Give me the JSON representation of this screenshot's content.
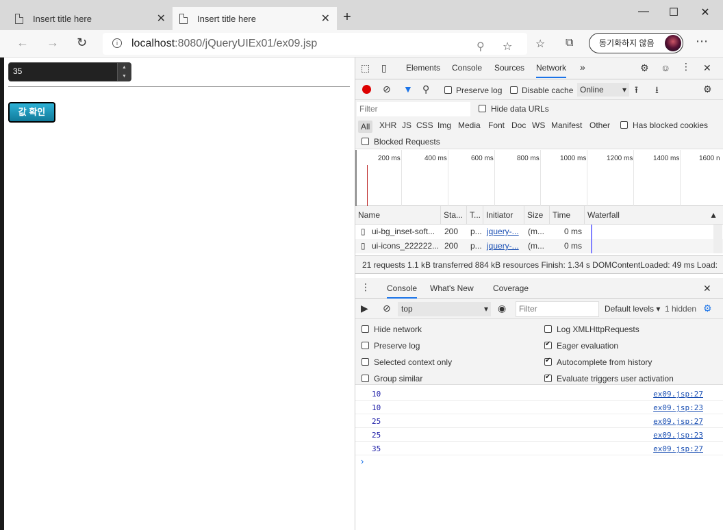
{
  "tabs": [
    {
      "title": "Insert title here"
    },
    {
      "title": "Insert title here"
    }
  ],
  "address": {
    "host": "localhost",
    "path": ":8080/jQueryUIEx01/ex09.jsp"
  },
  "sync_button": "동기화하지 않음",
  "page": {
    "spinner_value": "35",
    "check_button": "값 확인"
  },
  "devtools": {
    "tabs": [
      "Elements",
      "Console",
      "Sources",
      "Network"
    ],
    "active_tab": "Network",
    "network_toolbar": {
      "preserve_log": "Preserve log",
      "disable_cache": "Disable cache",
      "throttle": "Online"
    },
    "filter": {
      "placeholder": "Filter",
      "hide_data_urls": "Hide data URLs",
      "types": [
        "All",
        "XHR",
        "JS",
        "CSS",
        "Img",
        "Media",
        "Font",
        "Doc",
        "WS",
        "Manifest",
        "Other"
      ],
      "has_blocked_cookies": "Has blocked cookies",
      "blocked_requests": "Blocked Requests"
    },
    "timeline_ticks": [
      "200 ms",
      "400 ms",
      "600 ms",
      "800 ms",
      "1000 ms",
      "1200 ms",
      "1400 ms",
      "1600 n"
    ],
    "table": {
      "headers": [
        "Name",
        "Sta...",
        "T...",
        "Initiator",
        "Size",
        "Time",
        "Waterfall"
      ],
      "rows": [
        {
          "name": "ui-bg_inset-soft...",
          "status": "200",
          "type": "p...",
          "initiator": "jquery-...",
          "size": "(m...",
          "time": "0 ms"
        },
        {
          "name": "ui-icons_222222...",
          "status": "200",
          "type": "p...",
          "initiator": "jquery-...",
          "size": "(m...",
          "time": "0 ms"
        }
      ]
    },
    "summary": "21 requests   1.1 kB transferred   884 kB resources   Finish: 1.34 s   DOMContentLoaded: 49 ms   Load:",
    "drawer": {
      "tabs": [
        "Console",
        "What's New",
        "Coverage"
      ],
      "active": "Console"
    },
    "console_toolbar": {
      "context": "top",
      "filter_placeholder": "Filter",
      "levels": "Default levels",
      "hidden": "1 hidden"
    },
    "settings_left": [
      {
        "label": "Hide network",
        "checked": false
      },
      {
        "label": "Preserve log",
        "checked": false
      },
      {
        "label": "Selected context only",
        "checked": false
      },
      {
        "label": "Group similar",
        "checked": false
      }
    ],
    "settings_right": [
      {
        "label": "Log XMLHttpRequests",
        "checked": false
      },
      {
        "label": "Eager evaluation",
        "checked": true
      },
      {
        "label": "Autocomplete from history",
        "checked": true
      },
      {
        "label": "Evaluate triggers user activation",
        "checked": true
      }
    ],
    "logs": [
      {
        "value": "10",
        "source": "ex09.jsp:27"
      },
      {
        "value": "10",
        "source": "ex09.jsp:23"
      },
      {
        "value": "25",
        "source": "ex09.jsp:27"
      },
      {
        "value": "25",
        "source": "ex09.jsp:23"
      },
      {
        "value": "35",
        "source": "ex09.jsp:27"
      }
    ]
  }
}
